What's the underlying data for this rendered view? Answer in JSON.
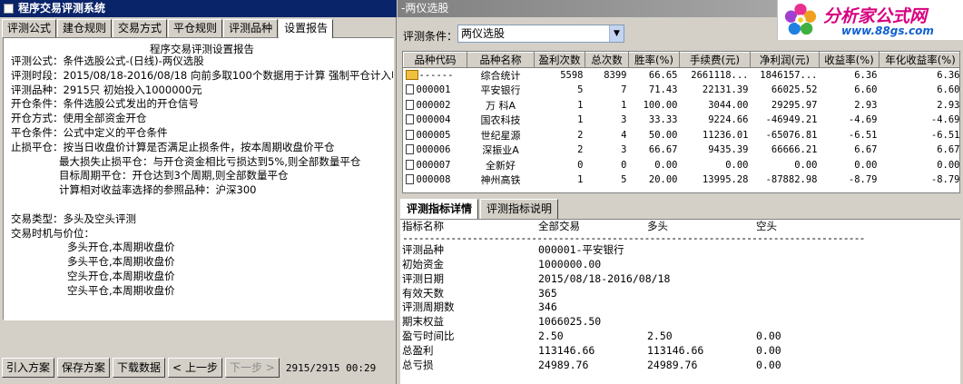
{
  "left_window": {
    "title": "程序交易评测系统",
    "tabs": [
      "评测公式",
      "建仓规则",
      "交易方式",
      "平仓规则",
      "评测品种",
      "设置报告"
    ],
    "active_tab_index": 5,
    "report": {
      "title": "程序交易评测设置报告",
      "lines": [
        "评测公式：条件选股公式-(日线)-两仪选股",
        "评测时段：2015/08/18-2016/08/18 向前多取100个数据用于计算 强制平仓计入收",
        "评测品种：2915只 初始投入1000000元",
        "开仓条件：条件选股公式发出的开仓信号",
        "开仓方式：使用全部资金开仓",
        "平仓条件：公式中定义的平仓条件",
        "止损平仓：按当日收盘价计算是否满足止损条件，按本周期收盘价平仓"
      ],
      "stop_lines": [
        "最大损失止损平仓：与开仓资金相比亏损达到5%,则全部数量平仓",
        "目标周期平仓：开仓达到3个周期,则全部数量平仓",
        "计算相对收益率选择的参照品种：沪深300"
      ],
      "trade_type": "交易类型：多头及空头评测",
      "trade_timing_label": "交易时机与价位：",
      "timing_lines": [
        "多头开仓,本周期收盘价",
        "多头平仓,本周期收盘价",
        "空头开仓,本周期收盘价",
        "空头平仓,本周期收盘价"
      ]
    },
    "buttons": [
      "引入方案",
      "保存方案",
      "下载数据",
      "上一步",
      "下一步"
    ],
    "status": "2915/2915 00:29"
  },
  "right_window": {
    "title": "-两仪选股",
    "brand_name": "分析家公式网",
    "brand_url": "www.88gs.com",
    "condition_label": "评测条件：",
    "condition_value": "两仪选股",
    "grid_headers": [
      "品种代码",
      "品种名称",
      "盈利次数",
      "总次数",
      "胜率(%)",
      "手续费(元)",
      "净利润(元)",
      "收益率(%)",
      "年化收益率(%)"
    ],
    "grid_rows": [
      {
        "code": "------",
        "name": "综合统计",
        "win": "5598",
        "total": "8399",
        "rate": "66.65",
        "fee": "2661118...",
        "profit": "1846157...",
        "ret": "6.36",
        "annual": "6.36",
        "icon": "folder-icon"
      },
      {
        "code": "000001",
        "name": "平安银行",
        "win": "5",
        "total": "7",
        "rate": "71.43",
        "fee": "22131.39",
        "profit": "66025.52",
        "ret": "6.60",
        "annual": "6.60",
        "icon": "document-icon"
      },
      {
        "code": "000002",
        "name": "万 科A",
        "win": "1",
        "total": "1",
        "rate": "100.00",
        "fee": "3044.00",
        "profit": "29295.97",
        "ret": "2.93",
        "annual": "2.93",
        "icon": "document-icon"
      },
      {
        "code": "000004",
        "name": "国农科技",
        "win": "1",
        "total": "3",
        "rate": "33.33",
        "fee": "9224.66",
        "profit": "-46949.21",
        "ret": "-4.69",
        "annual": "-4.69",
        "icon": "document-icon"
      },
      {
        "code": "000005",
        "name": "世纪星源",
        "win": "2",
        "total": "4",
        "rate": "50.00",
        "fee": "11236.01",
        "profit": "-65076.81",
        "ret": "-6.51",
        "annual": "-6.51",
        "icon": "document-icon"
      },
      {
        "code": "000006",
        "name": "深振业A",
        "win": "2",
        "total": "3",
        "rate": "66.67",
        "fee": "9435.39",
        "profit": "66666.21",
        "ret": "6.67",
        "annual": "6.67",
        "icon": "document-icon"
      },
      {
        "code": "000007",
        "name": "全新好",
        "win": "0",
        "total": "0",
        "rate": "0.00",
        "fee": "0.00",
        "profit": "0.00",
        "ret": "0.00",
        "annual": "0.00",
        "icon": "document-icon"
      },
      {
        "code": "000008",
        "name": "神州高铁",
        "win": "1",
        "total": "5",
        "rate": "20.00",
        "fee": "13995.28",
        "profit": "-87882.98",
        "ret": "-8.79",
        "annual": "-8.79",
        "icon": "document-icon"
      }
    ],
    "detail_tabs": [
      "评测指标详情",
      "评测指标说明"
    ],
    "active_detail_tab_index": 0,
    "detail_headers": [
      "指标名称",
      "全部交易",
      "多头",
      "空头"
    ],
    "separator": "--------------------------------------------------------------------------------------",
    "detail_rows": [
      {
        "name": "评测品种",
        "all": "000001-平安银行",
        "long": "",
        "short": ""
      },
      {
        "name": "初始资金",
        "all": "1000000.00",
        "long": "",
        "short": ""
      },
      {
        "name": "评测日期",
        "all": "2015/08/18-2016/08/18",
        "long": "",
        "short": ""
      },
      {
        "name": "有效天数",
        "all": "365",
        "long": "",
        "short": ""
      },
      {
        "name": "评测周期数",
        "all": "346",
        "long": "",
        "short": ""
      },
      {
        "name": "期末权益",
        "all": "1066025.50",
        "long": "",
        "short": ""
      },
      {
        "name": "盈亏时间比",
        "all": "2.50",
        "long": "2.50",
        "short": "0.00"
      },
      {
        "name": "总盈利",
        "all": "113146.66",
        "long": "113146.66",
        "short": "0.00"
      },
      {
        "name": "总亏损",
        "all": "24989.76",
        "long": "24989.76",
        "short": "0.00"
      }
    ]
  }
}
